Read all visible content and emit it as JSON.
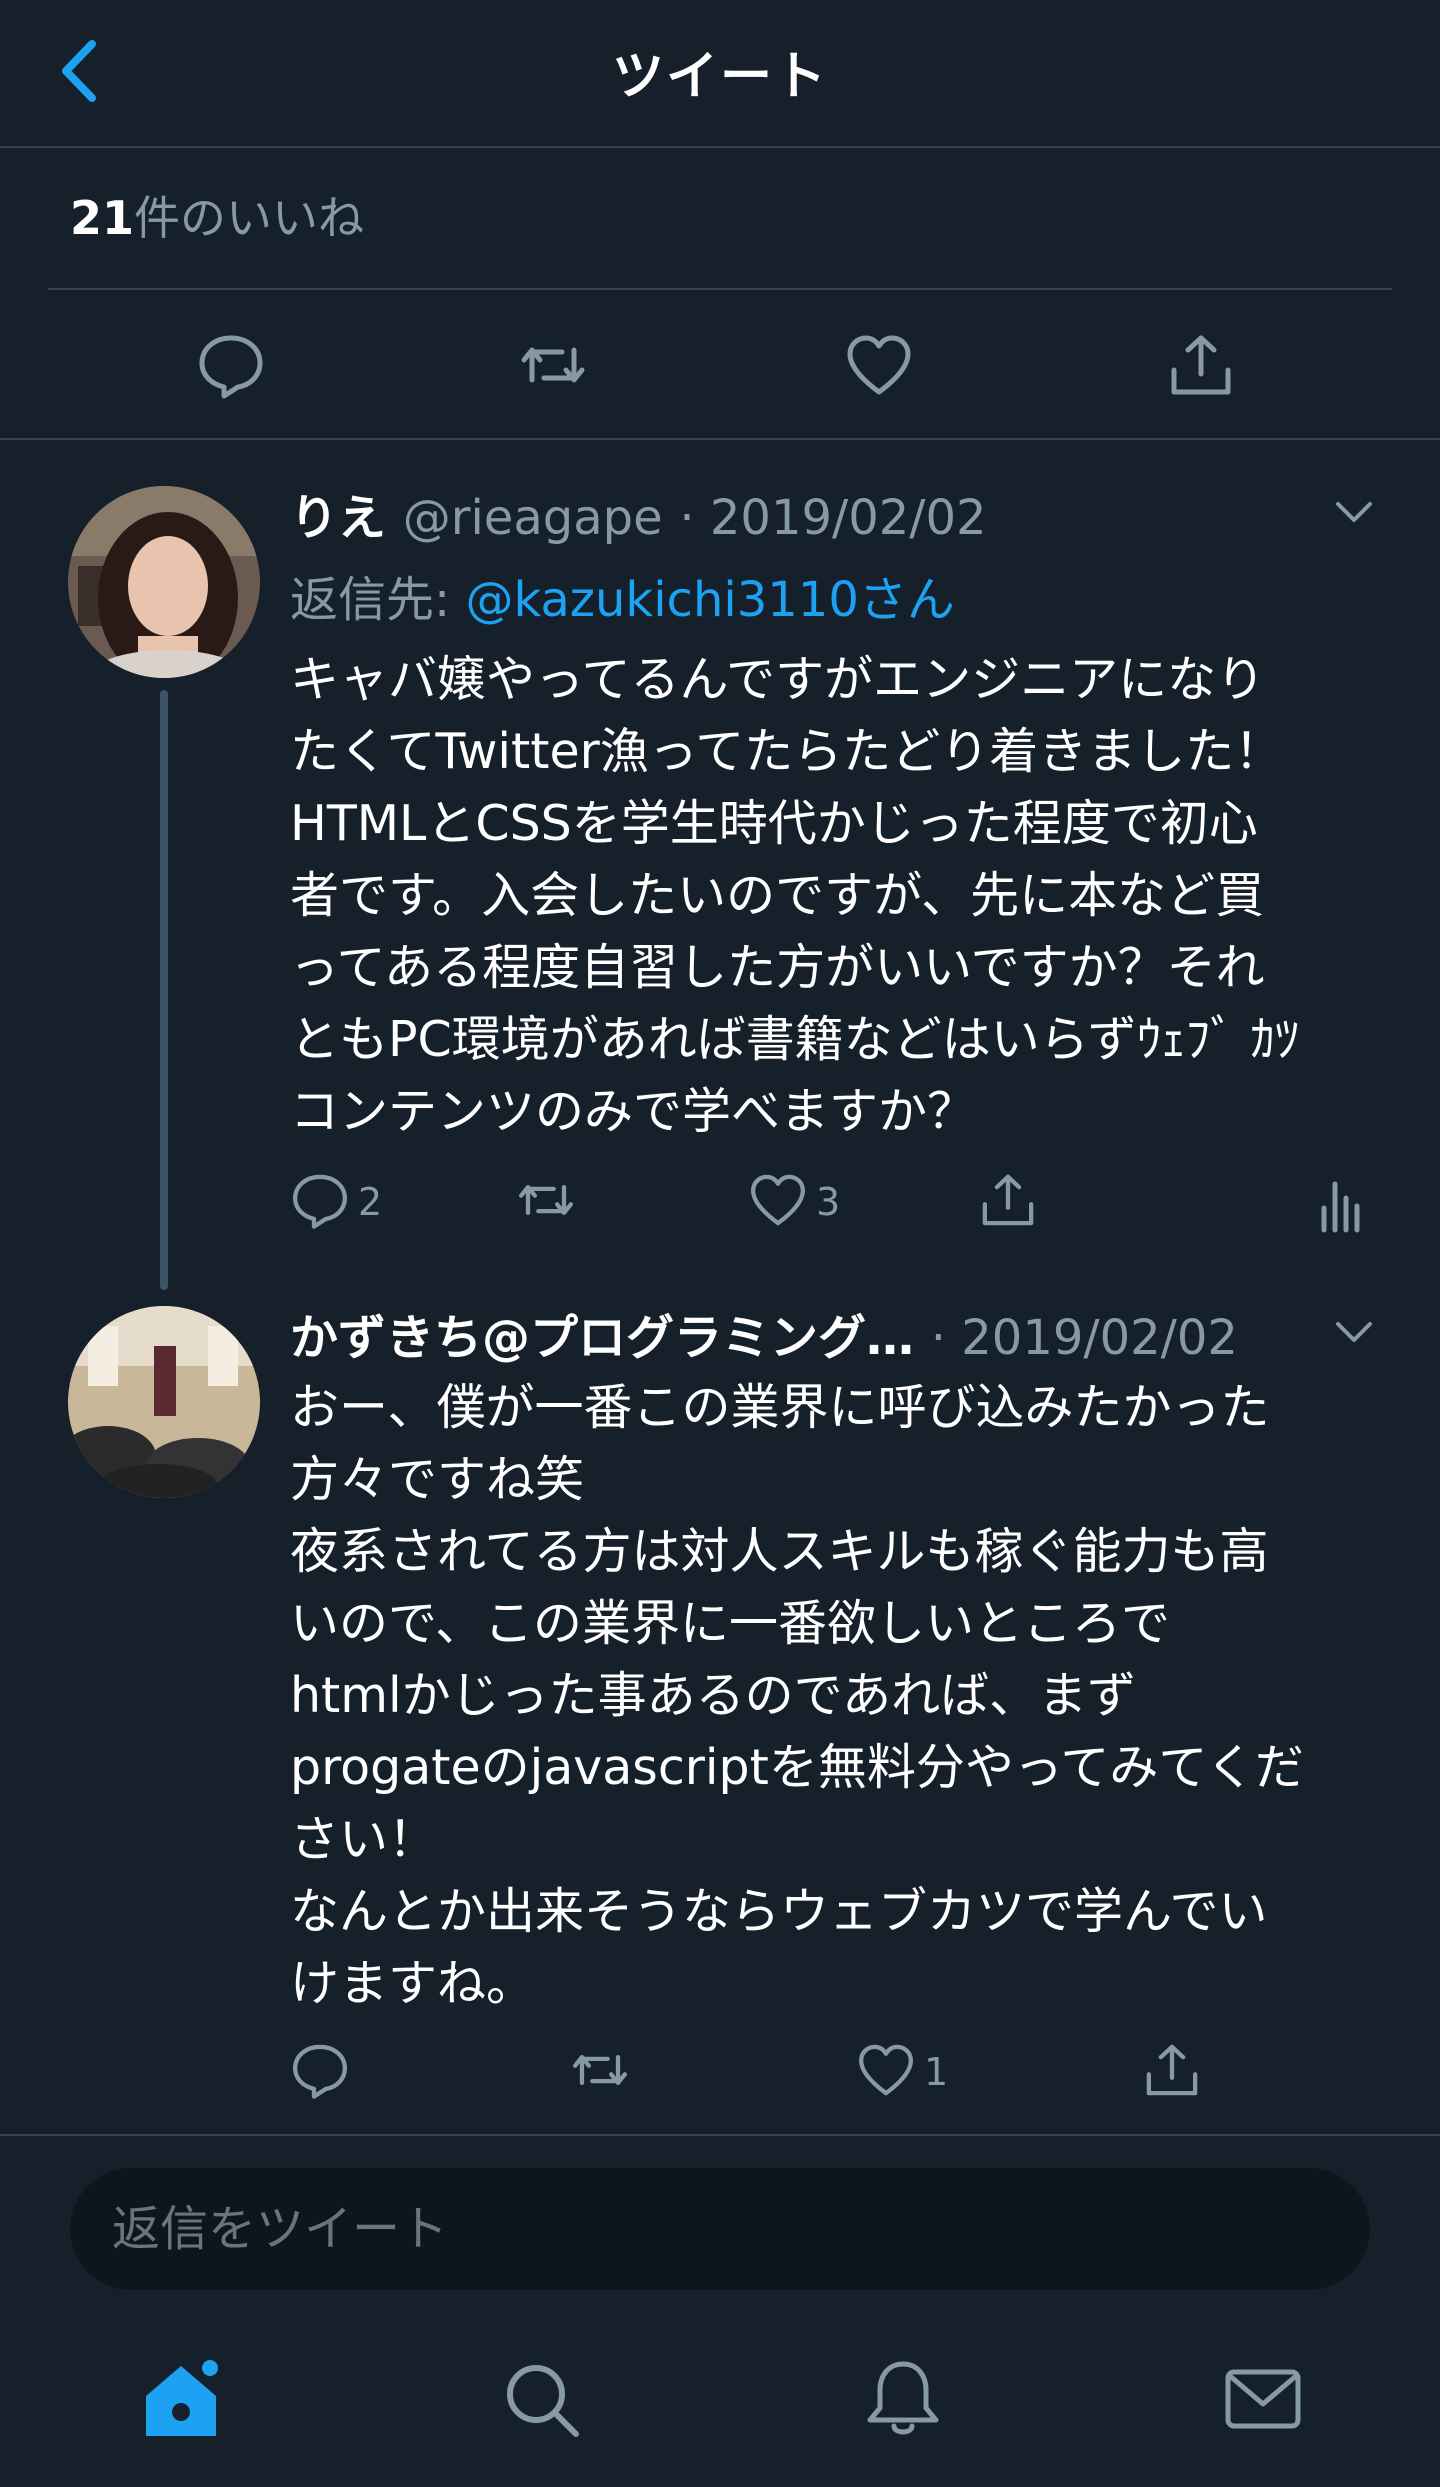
{
  "header": {
    "title": "ツイート",
    "back_icon": "chevron-left-icon"
  },
  "likes": {
    "count": "21",
    "suffix": "件のいいね"
  },
  "colors": {
    "background": "#15202b",
    "accent": "#1da1f2",
    "muted": "#8899a6",
    "divider": "#38444d"
  },
  "tweets": [
    {
      "display_name": "りえ",
      "handle": "@rieagape",
      "date": "· 2019/02/02",
      "reply_prefix": "返信先: ",
      "reply_to": "@kazukichi3110さん",
      "text": "キャバ嬢やってるんですがエンジニアになり\nたくてTwitter漁ってたらたどり着きました！\nHTMLとCSSを学生時代かじった程度で初心\n者です。入会したいのですが、先に本など買\nってある程度自習した方がいいですか？それ\nともPC環境があれば書籍などはいらずｳｪﾌﾞ ｶﾂ\nコンテンツのみで学べますか？",
      "reply_count": "2",
      "retweet_count": "",
      "like_count": "3"
    },
    {
      "display_name": "かずきち@プログラミング…",
      "date": "· 2019/02/02",
      "text": "おー、僕が一番この業界に呼び込みたかった\n方々ですね笑\n夜系されてる方は対人スキルも稼ぐ能力も高\nいので、この業界に一番欲しいところで\nhtmlかじった事あるのであれば、まず\nprogateのjavascriptを無料分やってみてくだ\nさい！\nなんとか出来そうならウェブカツで学んでい\nけますね。",
      "reply_count": "",
      "retweet_count": "",
      "like_count": "1"
    }
  ],
  "reply_input": {
    "placeholder": "返信をツイート"
  },
  "nav": [
    "home-icon",
    "search-icon",
    "notifications-icon",
    "messages-icon"
  ]
}
